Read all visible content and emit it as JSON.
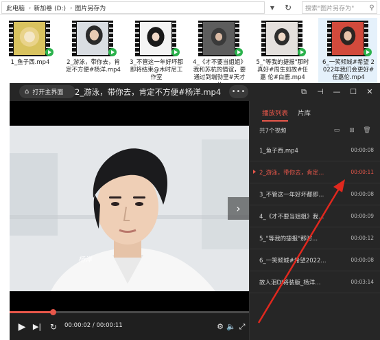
{
  "explorer": {
    "breadcrumb": [
      "此电脑",
      "新加卷 (D:)",
      "图片另存为"
    ],
    "search_placeholder": "搜索\"图片另存为\"",
    "files": [
      {
        "name": "1_鱼子西.mp4",
        "selected": false
      },
      {
        "name": "2_游泳，带你去，肯定不方便#杨洋.mp4",
        "selected": false
      },
      {
        "name": "3_不管这一年好坏都 即将结束@木时尼工 作室",
        "selected": false
      },
      {
        "name": "4_《才不要当姐姐》 我和苏杭的情谊，要 通过到端勃里#天才儿",
        "selected": false
      },
      {
        "name": "5_\"等我的捷报\"那时 真好#周生如故#任嘉 伦#白鹿.mp4",
        "selected": false
      },
      {
        "name": "6_一笑倾城#希望 2022年我们会更好# 任嘉伦.mp4",
        "selected": true
      }
    ]
  },
  "player": {
    "home_label": "打开主界面",
    "title": "2_游泳，带你去，肯定不方便#杨洋.mp4",
    "more_label": "•••",
    "titlebar_icons": [
      "screen-cast-icon",
      "pin-icon",
      "minimize-icon",
      "maximize-icon",
      "close-icon"
    ],
    "watermark": "杨洋",
    "progress": 0.18,
    "time_current": "00:00:02",
    "time_total": "00:00:11",
    "tabs": [
      {
        "label": "播放列表",
        "active": true
      },
      {
        "label": "片库",
        "active": false
      }
    ],
    "count_text": "共7个视频",
    "playlist": [
      {
        "name": "1_鱼子西.mp4",
        "duration": "00:00:08",
        "active": false
      },
      {
        "name": "2_游泳，带你去，肯定...",
        "duration": "00:00:11",
        "active": true
      },
      {
        "name": "3_不管这一年好坏都即...",
        "duration": "00:00:08",
        "active": false
      },
      {
        "name": "4_《才不要当姐姐》我...",
        "duration": "00:00:09",
        "active": false
      },
      {
        "name": "5_\"等我的捷报\"那时...",
        "duration": "00:00:12",
        "active": false
      },
      {
        "name": "6_一笑倾城#希望2022...",
        "duration": "00:00:08",
        "active": false
      },
      {
        "name": "故人泪DJ将装版_杨洋...",
        "duration": "00:03:14",
        "active": false
      }
    ],
    "accent_color": "#e8574a",
    "annotation_color": "#e0281e"
  }
}
